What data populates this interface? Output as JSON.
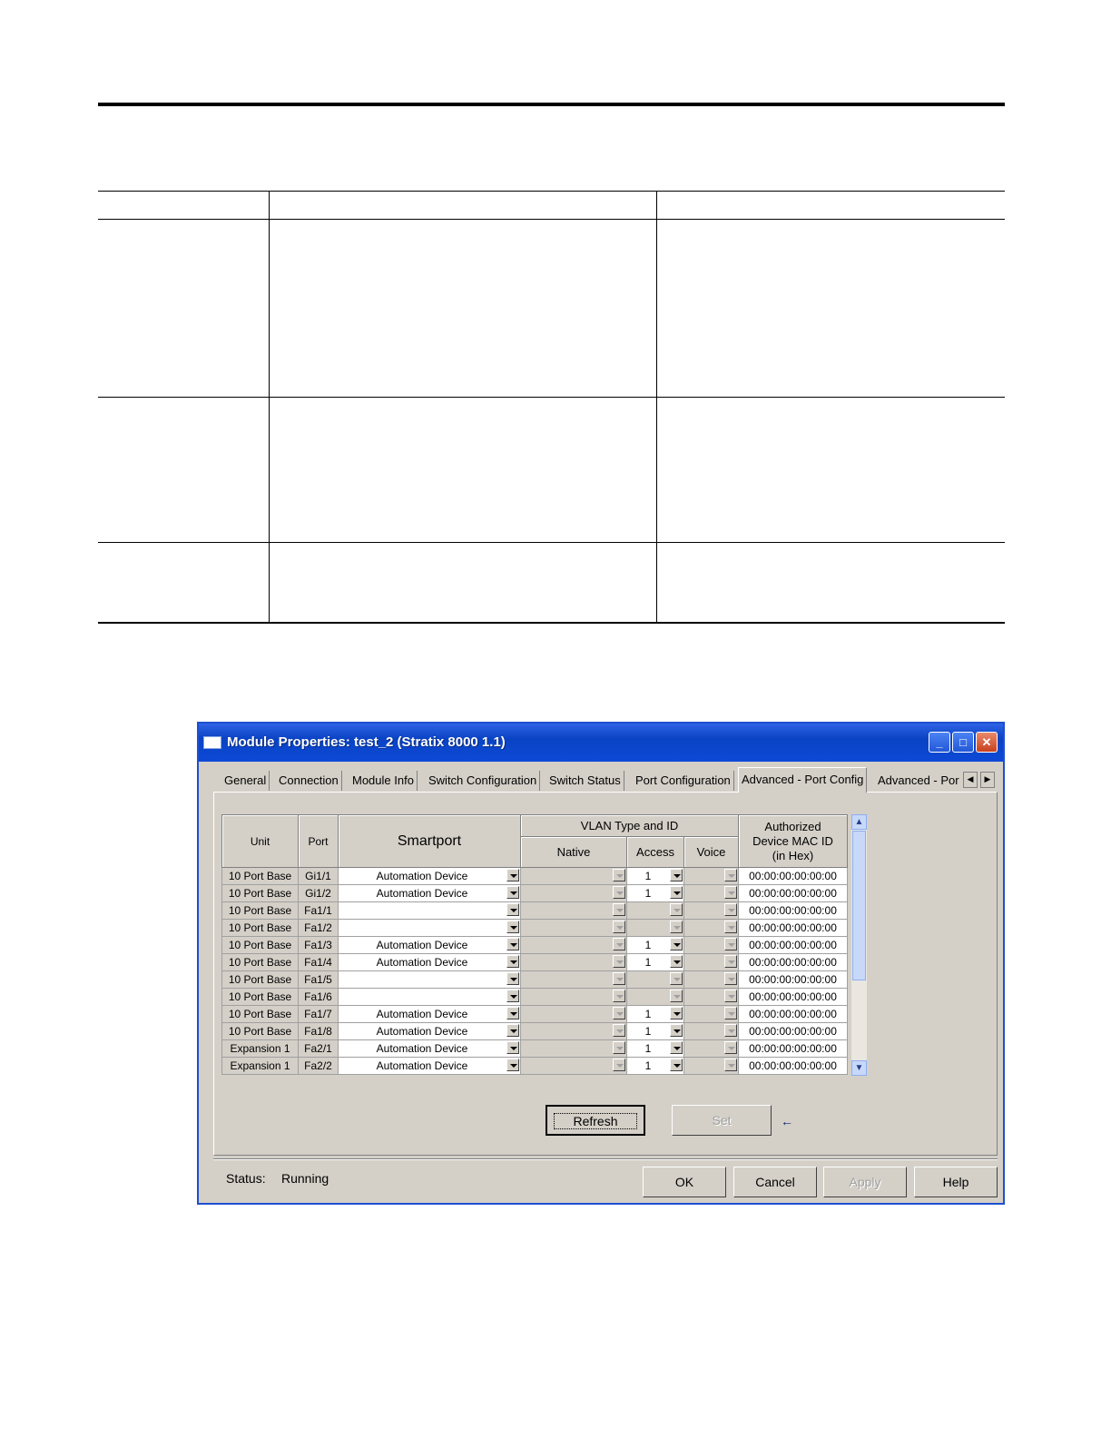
{
  "dialog": {
    "title": "Module Properties: test_2 (Stratix 8000 1.1)",
    "tabs": [
      "General",
      "Connection",
      "Module Info",
      "Switch Configuration",
      "Switch Status",
      "Port Configuration",
      "Advanced - Port Config",
      "Advanced - Por"
    ],
    "active_tab": "Advanced - Port Config",
    "columns": {
      "unit": "Unit",
      "port": "Port",
      "smartport": "Smartport",
      "vlan_group": "VLAN Type and ID",
      "native": "Native",
      "access": "Access",
      "voice": "Voice",
      "mac_line1": "Authorized",
      "mac_line2": "Device MAC ID",
      "mac_line3": "(in Hex)"
    },
    "rows": [
      {
        "unit": "10 Port Base",
        "port": "Gi1/1",
        "smartport": "Automation Device",
        "access": "1",
        "mac": "00:00:00:00:00:00"
      },
      {
        "unit": "10 Port Base",
        "port": "Gi1/2",
        "smartport": "Automation Device",
        "access": "1",
        "mac": "00:00:00:00:00:00"
      },
      {
        "unit": "10 Port Base",
        "port": "Fa1/1",
        "smartport": "",
        "access": "",
        "mac": "00:00:00:00:00:00"
      },
      {
        "unit": "10 Port Base",
        "port": "Fa1/2",
        "smartport": "",
        "access": "",
        "mac": "00:00:00:00:00:00"
      },
      {
        "unit": "10 Port Base",
        "port": "Fa1/3",
        "smartport": "Automation Device",
        "access": "1",
        "mac": "00:00:00:00:00:00"
      },
      {
        "unit": "10 Port Base",
        "port": "Fa1/4",
        "smartport": "Automation Device",
        "access": "1",
        "mac": "00:00:00:00:00:00"
      },
      {
        "unit": "10 Port Base",
        "port": "Fa1/5",
        "smartport": "",
        "access": "",
        "mac": "00:00:00:00:00:00"
      },
      {
        "unit": "10 Port Base",
        "port": "Fa1/6",
        "smartport": "",
        "access": "",
        "mac": "00:00:00:00:00:00"
      },
      {
        "unit": "10 Port Base",
        "port": "Fa1/7",
        "smartport": "Automation Device",
        "access": "1",
        "mac": "00:00:00:00:00:00"
      },
      {
        "unit": "10 Port Base",
        "port": "Fa1/8",
        "smartport": "Automation Device",
        "access": "1",
        "mac": "00:00:00:00:00:00"
      },
      {
        "unit": "Expansion 1",
        "port": "Fa2/1",
        "smartport": "Automation Device",
        "access": "1",
        "mac": "00:00:00:00:00:00"
      },
      {
        "unit": "Expansion 1",
        "port": "Fa2/2",
        "smartport": "Automation Device",
        "access": "1",
        "mac": "00:00:00:00:00:00"
      }
    ],
    "buttons": {
      "refresh": "Refresh",
      "set": "Set",
      "ok": "OK",
      "cancel": "Cancel",
      "apply": "Apply",
      "help": "Help"
    },
    "status_label": "Status:",
    "status_value": "Running"
  },
  "colors": {
    "titlebar": "#0a43c4",
    "dialog_bg": "#d4d0c8"
  }
}
